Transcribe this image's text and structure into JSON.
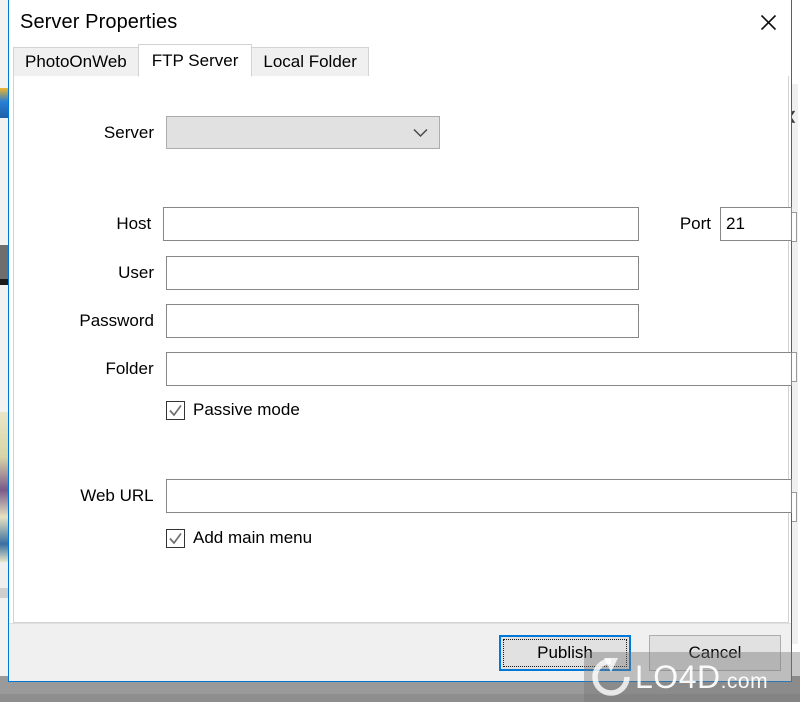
{
  "window": {
    "title": "Server Properties",
    "close_icon": "close-icon",
    "accent_color": "#0078d7"
  },
  "tabs": [
    {
      "label": "PhotoOnWeb",
      "active": false
    },
    {
      "label": "FTP Server",
      "active": true
    },
    {
      "label": "Local Folder",
      "active": false
    }
  ],
  "form": {
    "server": {
      "label": "Server",
      "value": "",
      "placeholder": "",
      "chevron_icon": "chevron-down-icon"
    },
    "host": {
      "label": "Host",
      "value": "",
      "placeholder": ""
    },
    "port": {
      "label": "Port",
      "value": "21",
      "placeholder": ""
    },
    "user": {
      "label": "User",
      "value": "",
      "placeholder": ""
    },
    "password": {
      "label": "Password",
      "value": "",
      "placeholder": ""
    },
    "folder": {
      "label": "Folder",
      "value": "",
      "placeholder": ""
    },
    "passive_mode": {
      "label": "Passive mode",
      "checked": true
    },
    "web_url": {
      "label": "Web URL",
      "value": "",
      "placeholder": ""
    },
    "add_main_menu": {
      "label": "Add main menu",
      "checked": true
    }
  },
  "footer": {
    "publish_label": "Publish",
    "cancel_label": "Cancel"
  },
  "watermark": {
    "name": "LO4D",
    "suffix": ".com"
  }
}
